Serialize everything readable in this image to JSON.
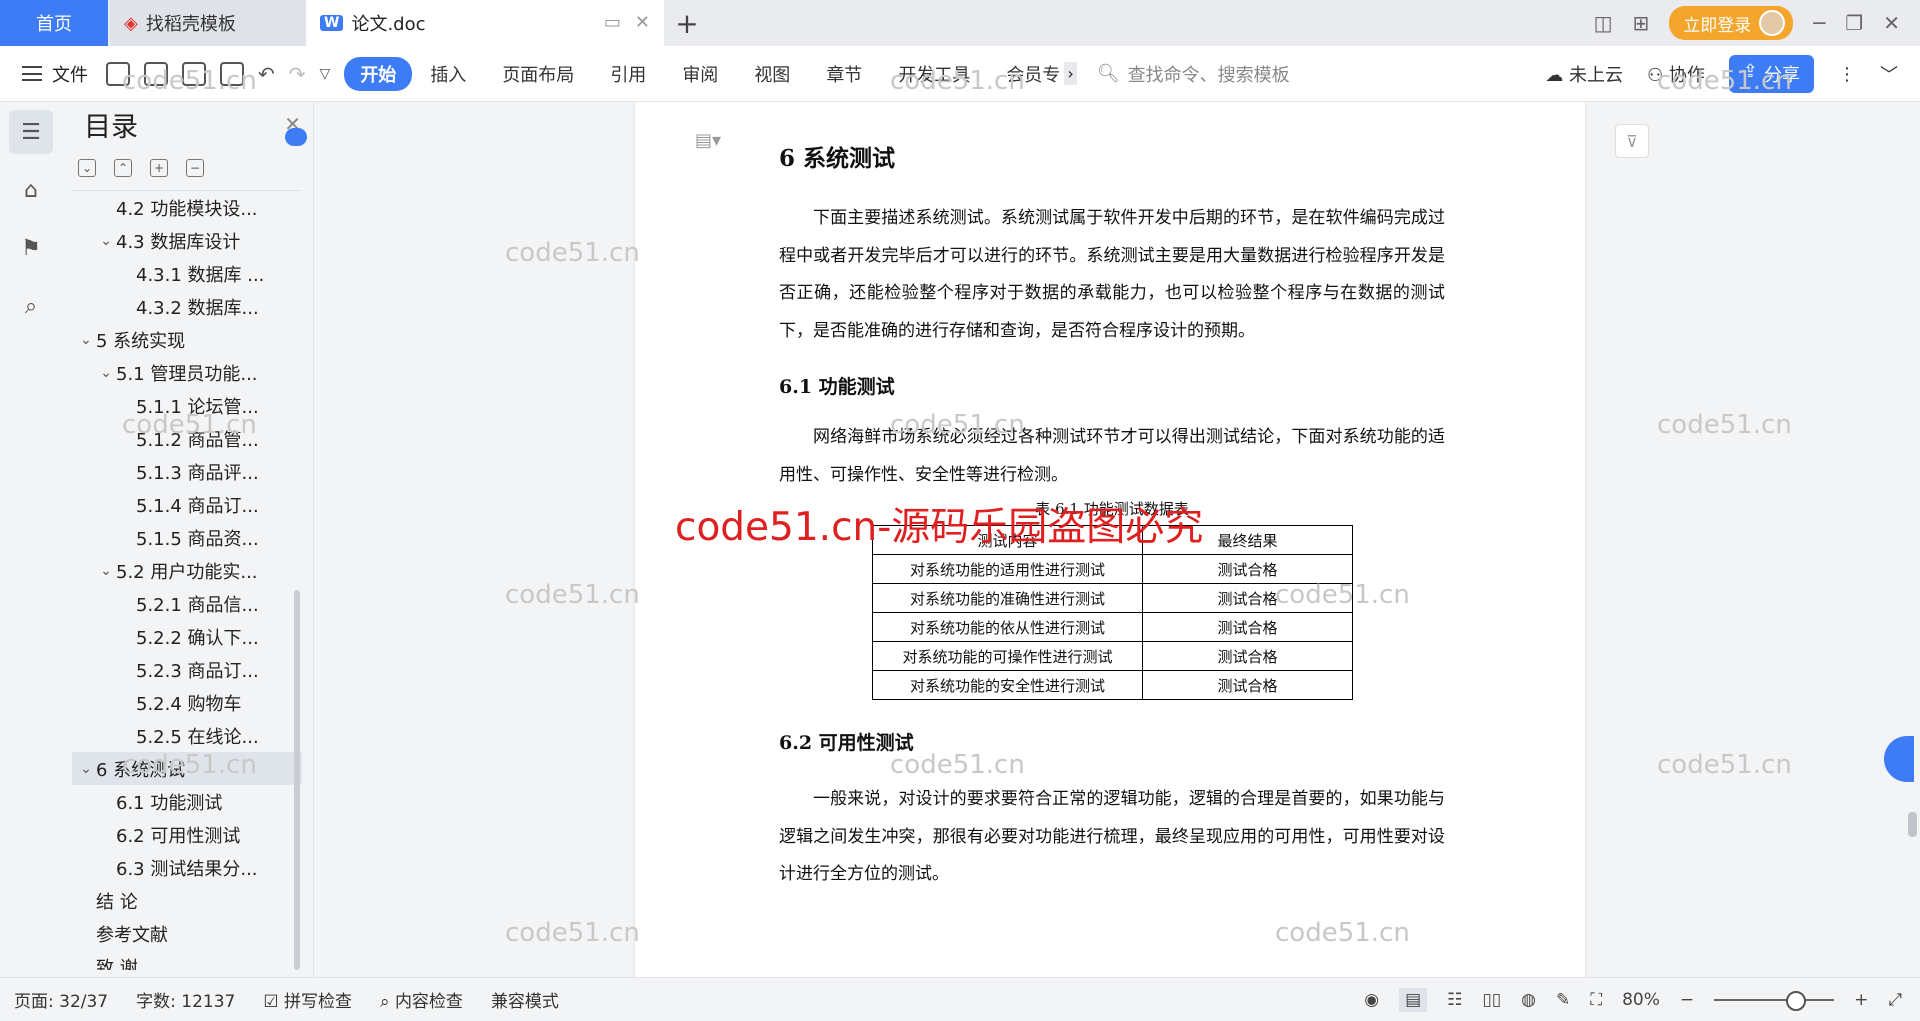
{
  "tabs": {
    "home": "首页",
    "template": "找稻壳模板",
    "doc": "论文.doc",
    "login": "立即登录"
  },
  "toolbar": {
    "file": "文件",
    "menu": [
      "开始",
      "插入",
      "页面布局",
      "引用",
      "审阅",
      "视图",
      "章节",
      "开发工具",
      "会员专"
    ],
    "search": "查找命令、搜索模板",
    "cloud": "未上云",
    "collab": "协作",
    "share": "分享"
  },
  "toc": {
    "title": "目录",
    "items": [
      {
        "label": "4.2 功能模块设...",
        "level": 2,
        "caret": ""
      },
      {
        "label": "4.3 数据库设计",
        "level": 2,
        "caret": "v"
      },
      {
        "label": "4.3.1 数据库 ...",
        "level": 3,
        "caret": ""
      },
      {
        "label": "4.3.2 数据库...",
        "level": 3,
        "caret": ""
      },
      {
        "label": "5 系统实现",
        "level": 1,
        "caret": "v"
      },
      {
        "label": "5.1 管理员功能...",
        "level": 2,
        "caret": "v"
      },
      {
        "label": "5.1.1 论坛管...",
        "level": 3,
        "caret": ""
      },
      {
        "label": "5.1.2 商品管...",
        "level": 3,
        "caret": ""
      },
      {
        "label": "5.1.3 商品评...",
        "level": 3,
        "caret": ""
      },
      {
        "label": "5.1.4 商品订...",
        "level": 3,
        "caret": ""
      },
      {
        "label": "5.1.5 商品资...",
        "level": 3,
        "caret": ""
      },
      {
        "label": "5.2 用户功能实...",
        "level": 2,
        "caret": "v"
      },
      {
        "label": "5.2.1 商品信...",
        "level": 3,
        "caret": ""
      },
      {
        "label": "5.2.2 确认下...",
        "level": 3,
        "caret": ""
      },
      {
        "label": "5.2.3 商品订...",
        "level": 3,
        "caret": ""
      },
      {
        "label": "5.2.4 购物车",
        "level": 3,
        "caret": ""
      },
      {
        "label": "5.2.5 在线论...",
        "level": 3,
        "caret": ""
      },
      {
        "label": "6 系统测试",
        "level": 1,
        "caret": "v",
        "selected": true
      },
      {
        "label": "6.1 功能测试",
        "level": 2,
        "caret": ""
      },
      {
        "label": "6.2 可用性测试",
        "level": 2,
        "caret": ""
      },
      {
        "label": "6.3 测试结果分...",
        "level": 2,
        "caret": ""
      },
      {
        "label": "结 论",
        "level": 1,
        "caret": ""
      },
      {
        "label": "参考文献",
        "level": 1,
        "caret": ""
      },
      {
        "label": "致 谢",
        "level": 1,
        "caret": ""
      }
    ]
  },
  "doc": {
    "h1": "6  系统测试",
    "p1": "下面主要描述系统测试。系统测试属于软件开发中后期的环节，是在软件编码完成过程中或者开发完毕后才可以进行的环节。系统测试主要是用大量数据进行检验程序开发是否正确，还能检验整个程序对于数据的承载能力，也可以检验整个程序与在数据的测试下，是否能准确的进行存储和查询，是否符合程序设计的预期。",
    "h2a": "6.1  功能测试",
    "p2": "网络海鲜市场系统必须经过各种测试环节才可以得出测试结论，下面对系统功能的适用性、可操作性、安全性等进行检测。",
    "table_caption": "表 6.1  功能测试数据表",
    "table_header": [
      "测试内容",
      "最终结果"
    ],
    "table_rows": [
      [
        "对系统功能的适用性进行测试",
        "测试合格"
      ],
      [
        "对系统功能的准确性进行测试",
        "测试合格"
      ],
      [
        "对系统功能的依从性进行测试",
        "测试合格"
      ],
      [
        "对系统功能的可操作性进行测试",
        "测试合格"
      ],
      [
        "对系统功能的安全性进行测试",
        "测试合格"
      ]
    ],
    "h2b": "6.2  可用性测试",
    "p3": "一般来说，对设计的要求要符合正常的逻辑功能，逻辑的合理是首要的，如果功能与逻辑之间发生冲突，那很有必要对功能进行梳理，最终呈现应用的可用性，可用性要对设计进行全方位的测试。"
  },
  "watermark": {
    "text": "code51.cn",
    "red": "code51.cn-源码乐园盗图必究"
  },
  "status": {
    "page": "页面: 32/37",
    "words": "字数: 12137",
    "spell": "拼写检查",
    "content": "内容检查",
    "compat": "兼容模式",
    "zoom": "80%"
  }
}
